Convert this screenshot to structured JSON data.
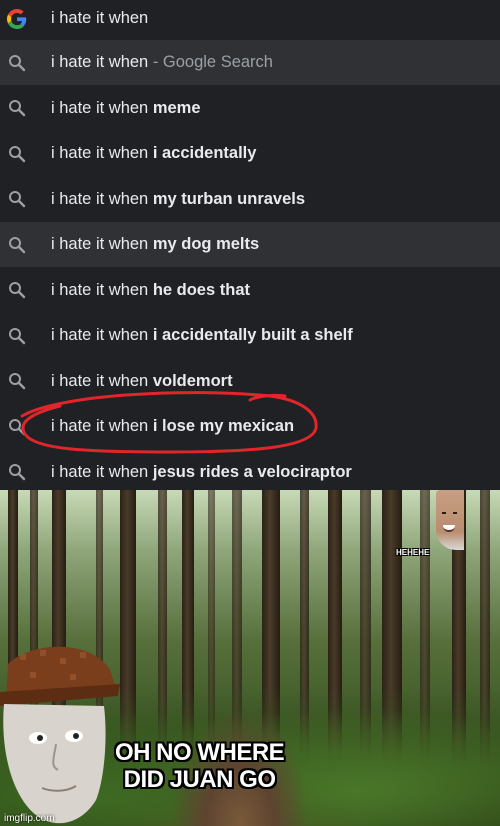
{
  "search": {
    "query_prefix": "i hate it when",
    "input_value": "i hate it when",
    "suggestions": [
      {
        "prefix": "i hate it when",
        "bold": "",
        "suffix": " - Google Search",
        "highlight": true
      },
      {
        "prefix": "i hate it when ",
        "bold": "meme",
        "suffix": "",
        "highlight": false
      },
      {
        "prefix": "i hate it when ",
        "bold": "i accidentally",
        "suffix": "",
        "highlight": false
      },
      {
        "prefix": "i hate it when ",
        "bold": "my turban unravels",
        "suffix": "",
        "highlight": false
      },
      {
        "prefix": "i hate it when ",
        "bold": "my dog melts",
        "suffix": "",
        "highlight": true
      },
      {
        "prefix": "i hate it when ",
        "bold": "he does that",
        "suffix": "",
        "highlight": false
      },
      {
        "prefix": "i hate it when ",
        "bold": "i accidentally built a shelf",
        "suffix": "",
        "highlight": false
      },
      {
        "prefix": "i hate it when ",
        "bold": "voldemort",
        "suffix": "",
        "highlight": false
      },
      {
        "prefix": "i hate it when ",
        "bold": "i lose my mexican",
        "suffix": "",
        "highlight": false,
        "circled": true
      },
      {
        "prefix": "i hate it when ",
        "bold": "jesus rides a velociraptor",
        "suffix": "",
        "highlight": false
      }
    ],
    "icons": {
      "logo": "google-g-icon",
      "suggestion": "search-icon"
    },
    "colors": {
      "background": "#202124",
      "highlight": "#303134",
      "text": "#e8eaed",
      "muted": "#9aa0a6",
      "circle": "#e0262b"
    }
  },
  "meme": {
    "caption_line1": "OH NO WHERE",
    "caption_line2": "DID JUAN GO",
    "small_text": "HEHEHE",
    "watermark": "imgflip.com"
  }
}
